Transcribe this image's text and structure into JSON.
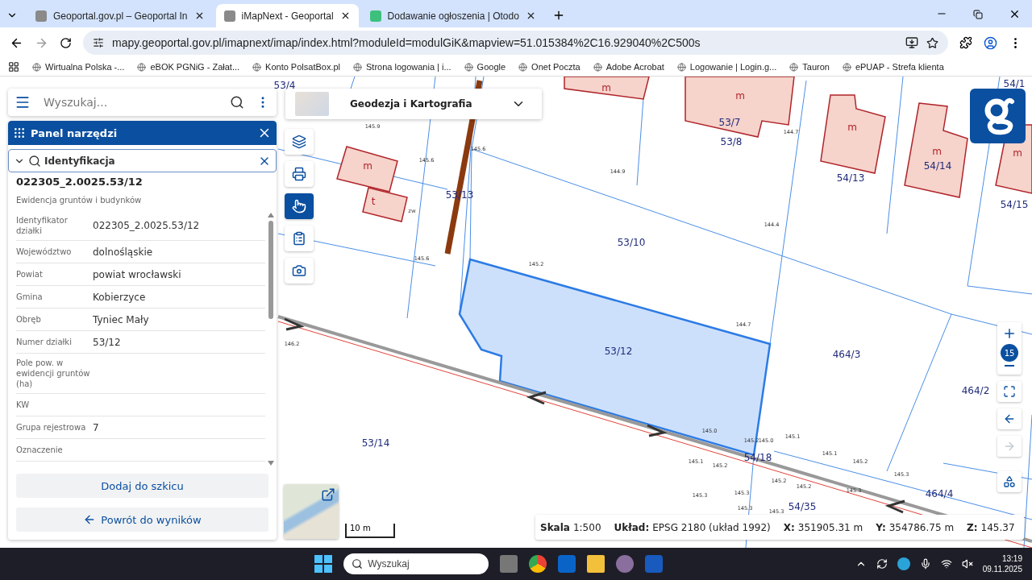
{
  "browser": {
    "tabs": [
      {
        "title": "Geoportal.gov.pl – Geoportal In",
        "selected": false,
        "kind": "geoportal"
      },
      {
        "title": "iMapNext - Geoportal",
        "selected": true,
        "kind": "geoportal"
      },
      {
        "title": "Dodawanie ogłoszenia | Otodo",
        "selected": false,
        "kind": "otodom"
      }
    ],
    "url": "mapy.geoportal.gov.pl/imapnext/imap/index.html?moduleId=modulGiK&mapview=51.015384%2C16.929040%2C500s",
    "bookmarks": [
      "Wirtualna Polska -...",
      "eBOK PGNiG - Załat...",
      "Konto PolsatBox.pl",
      "Strona logowania | i...",
      "Google",
      "Onet Poczta",
      "Adobe Acrobat",
      "Logowanie | Login.g...",
      "Tauron",
      "ePUAP - Strefa klienta"
    ]
  },
  "app": {
    "search": {
      "placeholder": "Wyszukaj..."
    },
    "tool_panel": {
      "title": "Panel narzędzi"
    },
    "section": {
      "title": "Identyfikacja",
      "expanded": true
    },
    "result": {
      "id": "022305_2.0025.53/12",
      "subtitle": "Ewidencja gruntów i budynków",
      "attributes": [
        {
          "label": "Identyfikator działki",
          "value": "022305_2.0025.53/12"
        },
        {
          "label": "Województwo",
          "value": "dolnośląskie"
        },
        {
          "label": "Powiat",
          "value": "powiat wrocławski"
        },
        {
          "label": "Gmina",
          "value": "Kobierzyce"
        },
        {
          "label": "Obręb",
          "value": "Tyniec Mały"
        },
        {
          "label": "Numer działki",
          "value": "53/12"
        },
        {
          "label": "Pole pow. w ewidencji gruntów (ha)"
        },
        {
          "label": "KW"
        },
        {
          "label": "Grupa rejestrowa",
          "value": "7"
        },
        {
          "label": "Oznaczenie"
        }
      ]
    },
    "buttons": [
      {
        "label": "Dodaj do szkicu",
        "kind": "plain"
      },
      {
        "label": "Powrót do wyników",
        "kind": "back"
      }
    ],
    "basemap_selector": {
      "title": "Geodezja i Kartografia"
    },
    "tools": [
      {
        "kind": "layers",
        "selected": false
      },
      {
        "kind": "print",
        "selected": false
      },
      {
        "kind": "identify",
        "selected": true
      },
      {
        "kind": "clipboard",
        "selected": false
      },
      {
        "kind": "camera",
        "selected": false
      }
    ],
    "zoom_level": "15",
    "nav": [
      {
        "kind": "fullscreen",
        "disabled": false
      },
      {
        "kind": "back",
        "disabled": false
      },
      {
        "kind": "forward",
        "disabled": true
      },
      {
        "kind": "legend",
        "disabled": false
      }
    ],
    "scale_bar": "10 m",
    "status": [
      {
        "label": "Skala",
        "value": "1:500"
      },
      {
        "label": "Układ:",
        "value": "EPSG 2180 (układ 1992)"
      },
      {
        "label": "X:",
        "value": "351905.31 m"
      },
      {
        "label": "Y:",
        "value": "354786.75 m"
      },
      {
        "label": "Z:",
        "value": "145.37"
      }
    ]
  },
  "map": {
    "parcels": [
      "53/4",
      "53/7",
      "53/8",
      "54/13",
      "54/14",
      "54/15",
      "54/1",
      "53/13",
      "53/10",
      "53/12",
      "464/3",
      "464/2",
      "53/14",
      "54/18",
      "54/35",
      "464/4"
    ],
    "buildings": [
      "m",
      "m",
      "m",
      "t",
      "zw",
      "m",
      "m",
      "m"
    ],
    "elevations": [
      "145.9",
      "145.6",
      "145.6",
      "145.6",
      "144.9",
      "144.4",
      "144.7",
      "145.2",
      "144.7",
      "146.2",
      "145.0",
      "145.1",
      "145.2",
      "145.0",
      "145.1",
      "145.2",
      "145.1",
      "145.2",
      "145.3",
      "145.3",
      "145.3",
      "145.2",
      "145.2",
      "145.3",
      "145.3",
      "145.3"
    ]
  },
  "taskbar": {
    "search": {
      "placeholder": "Wyszukaj"
    },
    "time": "13:19",
    "date": "09.11.2025"
  }
}
